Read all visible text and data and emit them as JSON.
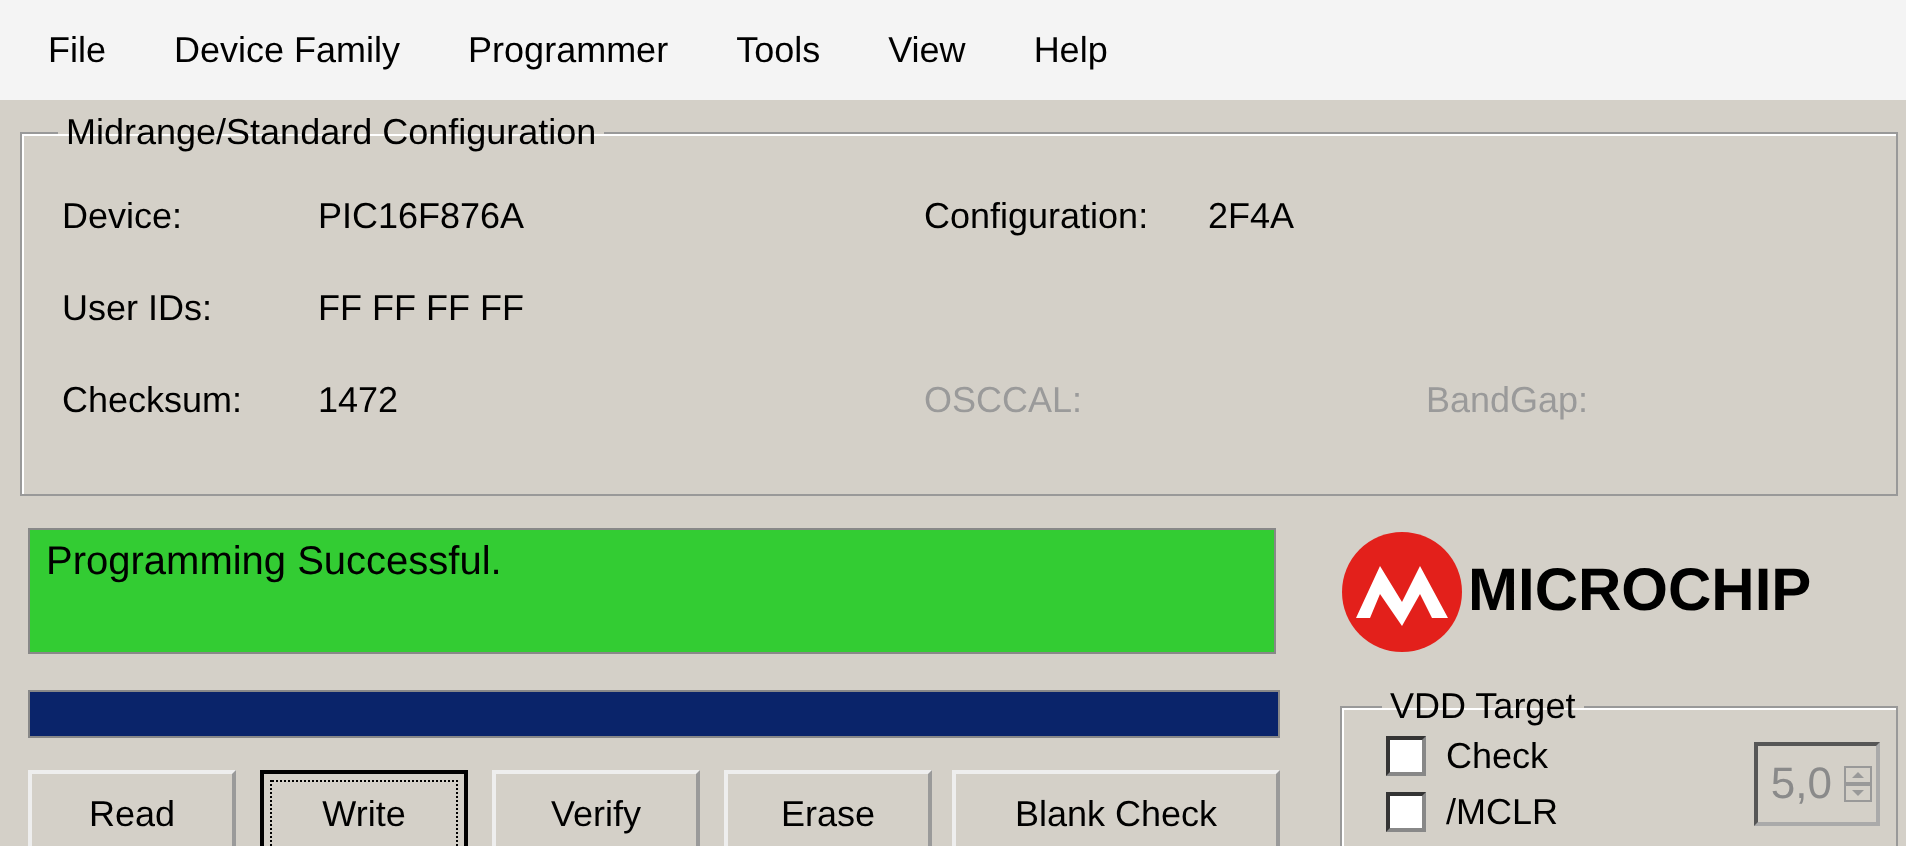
{
  "menu": [
    {
      "label": "File"
    },
    {
      "label": "Device Family"
    },
    {
      "label": "Programmer"
    },
    {
      "label": "Tools"
    },
    {
      "label": "View"
    },
    {
      "label": "Help"
    }
  ],
  "config": {
    "title": "Midrange/Standard Configuration",
    "rows": [
      [
        {
          "label": "Device:",
          "value": "PIC16F876A",
          "disabled": false
        },
        {
          "label": "Configuration:",
          "value": "2F4A",
          "disabled": false
        }
      ],
      [
        {
          "label": "User IDs:",
          "value": "FF FF FF FF",
          "disabled": false
        }
      ],
      [
        {
          "label": "Checksum:",
          "value": "1472",
          "disabled": false
        },
        {
          "label": "OSCCAL:",
          "disabled": true
        },
        {
          "label": "BandGap:",
          "disabled": true
        }
      ]
    ]
  },
  "status": {
    "message": "Programming Successful.",
    "color": "#33cc33"
  },
  "logo": {
    "text": "MICROCHIP"
  },
  "progress": {
    "level": 1
  },
  "buttons": [
    {
      "label": "Read",
      "focused": false
    },
    {
      "label": "Write",
      "focused": true
    },
    {
      "label": "Verify",
      "focused": false
    },
    {
      "label": "Erase",
      "focused": false
    },
    {
      "label": "Blank Check",
      "focused": false
    }
  ],
  "vdd": {
    "title": "VDD Target",
    "checks": [
      {
        "label": "Check",
        "checked": false
      },
      {
        "label": "/MCLR",
        "checked": false
      }
    ],
    "voltage": "5,0",
    "disabled": true
  }
}
